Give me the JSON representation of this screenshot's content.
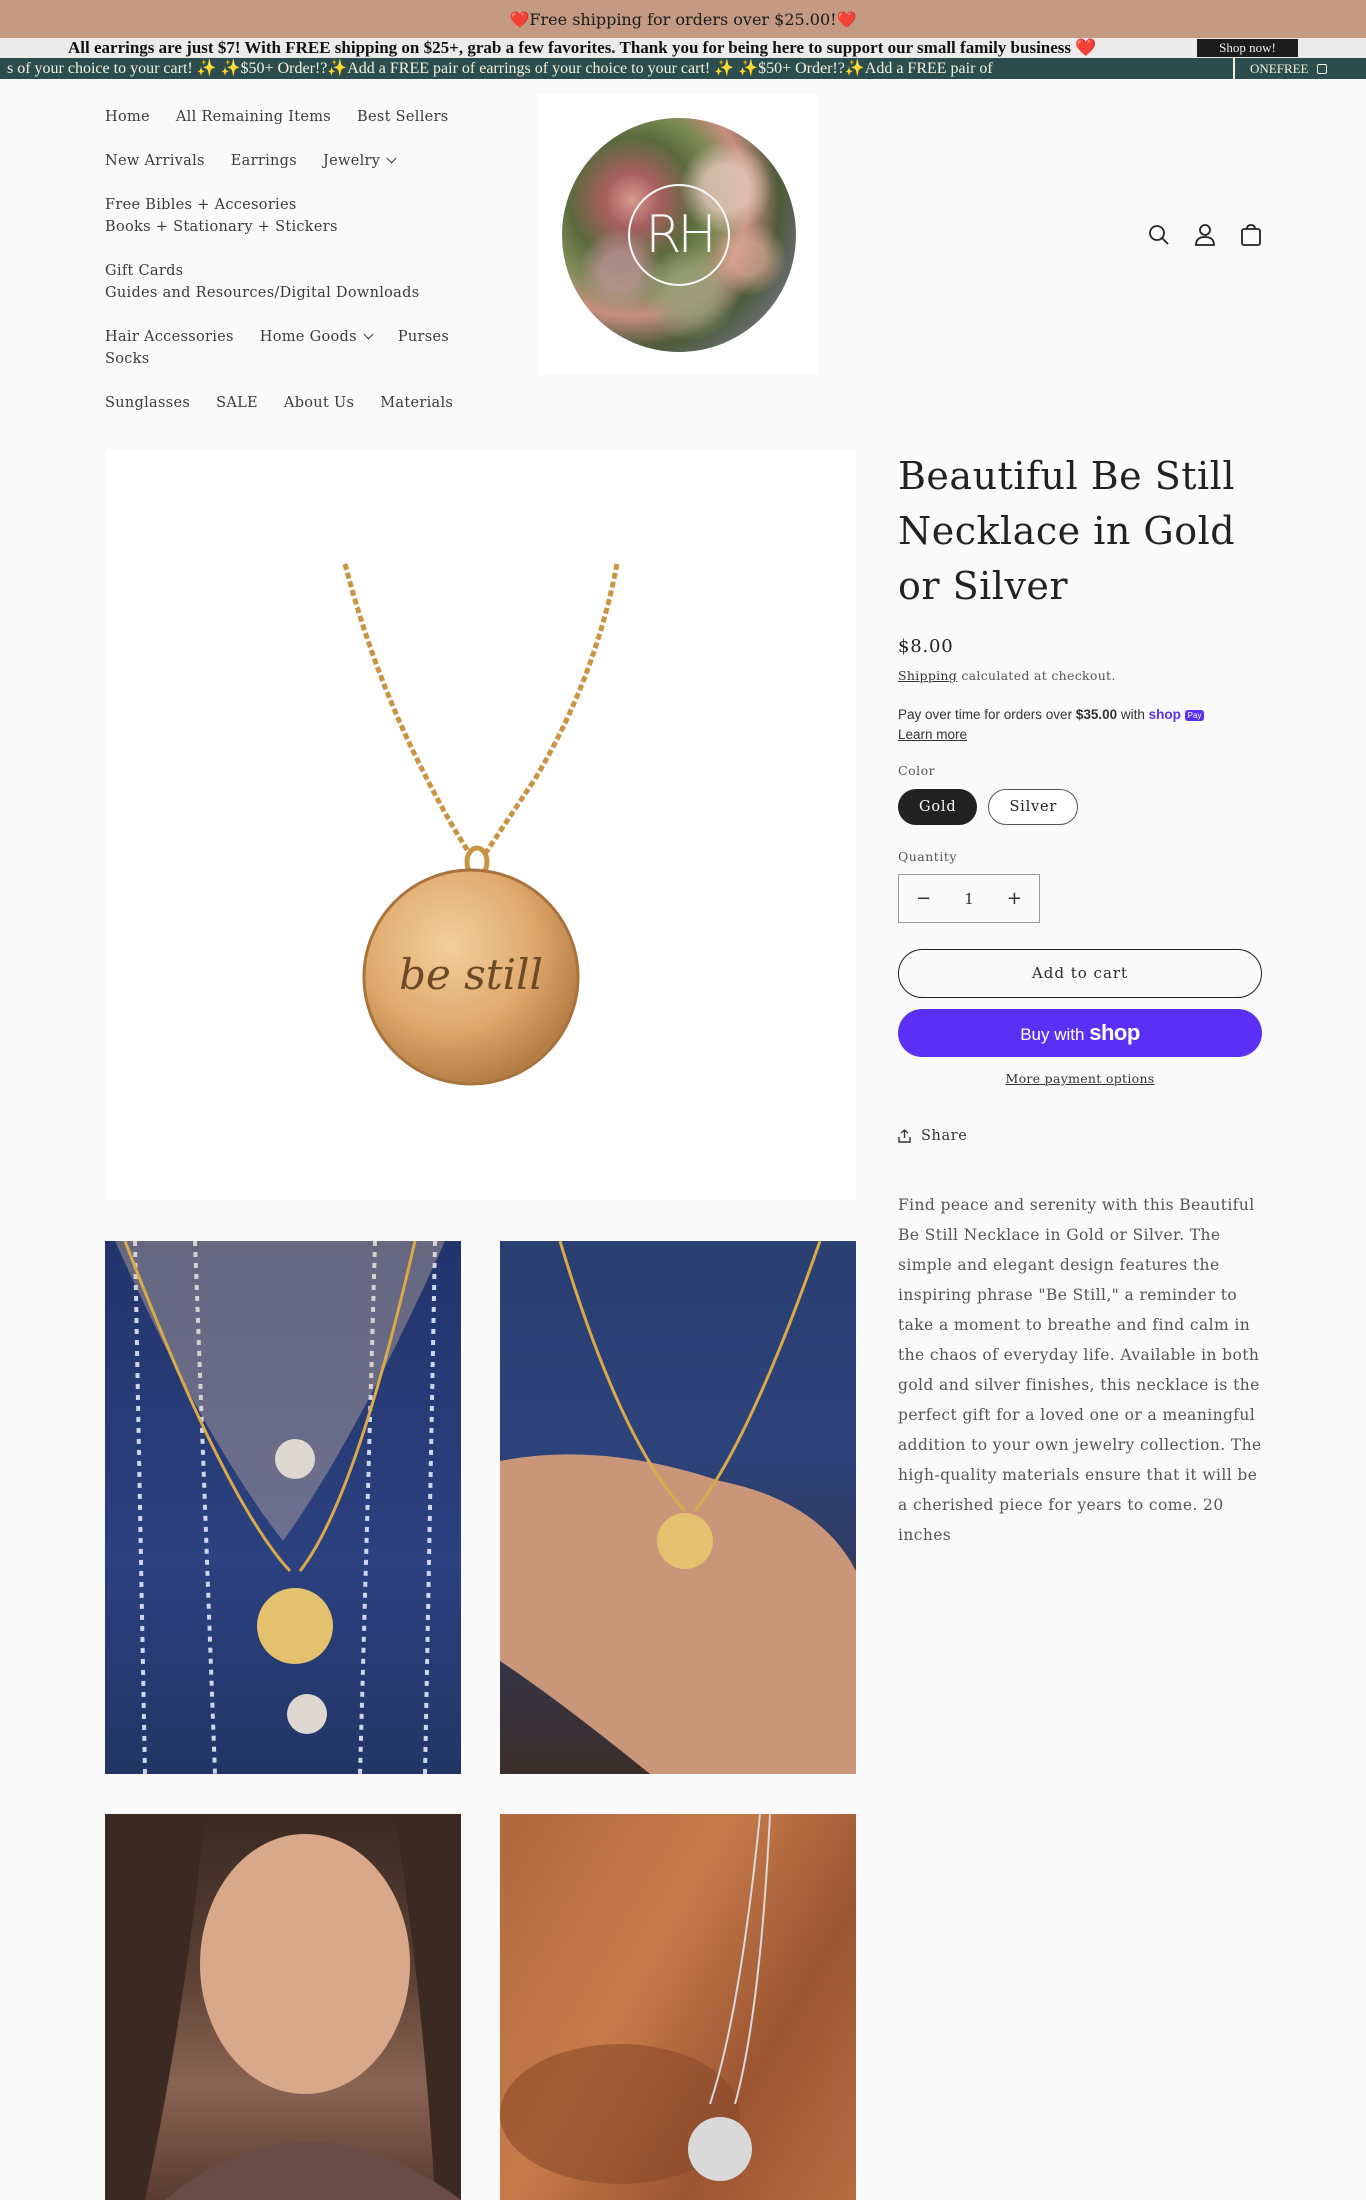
{
  "announcement": {
    "bar1_text": "❤️Free shipping for orders over $25.00!❤️",
    "bar2_text": "All earrings are just $7!  With FREE shipping on $25+, grab a few favorites. Thank you for being here to support our small family business ❤️",
    "bar2_button": "Shop now!",
    "marquee_text": "s of your choice to your cart! ✨    ✨$50+ Order!?✨Add a FREE pair of earrings of your choice to your cart! ✨    ✨$50+ Order!?✨Add a FREE pair of",
    "promo_code": "ONEFREE"
  },
  "nav": {
    "rows": [
      [
        "Home",
        "All Remaining Items",
        "Best Sellers"
      ],
      [
        "New Arrivals",
        "Earrings",
        "Jewelry"
      ],
      [
        "Free Bibles + Accesories",
        "Books + Stationary + Stickers"
      ],
      [
        "Gift Cards",
        "Guides and Resources/Digital Downloads"
      ],
      [
        "Hair Accessories",
        "Home Goods",
        "Purses",
        "Socks"
      ],
      [
        "Sunglasses",
        "SALE",
        "About Us",
        "Materials"
      ]
    ]
  },
  "logo": {
    "monogram": "RH"
  },
  "header_icons": [
    "search-icon",
    "account-icon",
    "cart-icon"
  ],
  "product": {
    "title": "Beautiful Be Still Necklace in Gold or Silver",
    "price": "$8.00",
    "shipping_link": "Shipping",
    "shipping_note": " calculated at checkout.",
    "payover_text": "Pay over time for orders over ",
    "payover_amount": "$35.00",
    "payover_with": " with ",
    "shoppay_label": "shop",
    "shoppay_badge": "Pay",
    "learn_more": "Learn more",
    "color_label": "Color",
    "colors": [
      "Gold",
      "Silver"
    ],
    "selected_color": "Gold",
    "quantity_label": "Quantity",
    "quantity": "1",
    "add_to_cart": "Add to cart",
    "buy_with": "Buy with ",
    "buy_brand": "shop",
    "more_payment": "More payment options",
    "share": "Share",
    "pendant_text": "be still",
    "description": "Find peace and serenity with this Beautiful Be Still Necklace in Gold or Silver. The simple and elegant design features the inspiring phrase \"Be Still,\" a reminder to take a moment to breathe and find calm in the chaos of everyday life. Available in both gold and silver finishes, this necklace is the perfect gift for a loved one or a meaningful addition to your own jewelry collection. The high-quality materials ensure that it will be a cherished piece for years to come. 20 inches"
  },
  "colors": {
    "brand_bar": "#c49a83",
    "marquee_bg": "#2c4d4e",
    "shop_pay": "#5a31f4"
  }
}
